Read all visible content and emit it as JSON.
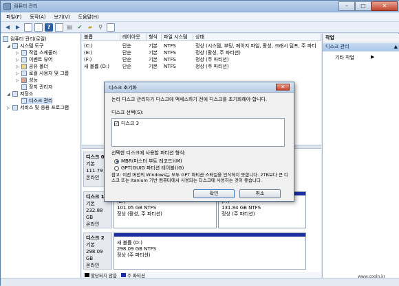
{
  "window": {
    "title": "컴퓨터 관리"
  },
  "title_controls": {
    "minimize": "–",
    "maximize": "□",
    "close": "✕"
  },
  "menubar": [
    "파일(F)",
    "동작(A)",
    "보기(V)",
    "도움말(H)"
  ],
  "tree": [
    {
      "label": "컴퓨터 관리(로컬)",
      "expander": "",
      "level": 0
    },
    {
      "label": "시스템 도구",
      "expander": "◢",
      "level": 1
    },
    {
      "label": "작업 스케줄러",
      "expander": "▷",
      "level": 2
    },
    {
      "label": "이벤트 뷰어",
      "expander": "▷",
      "level": 2
    },
    {
      "label": "공유 폴더",
      "expander": "▷",
      "level": 2
    },
    {
      "label": "로컬 사용자 및 그룹",
      "expander": "▷",
      "level": 2
    },
    {
      "label": "성능",
      "expander": "▷",
      "level": 2
    },
    {
      "label": "장치 관리자",
      "expander": "",
      "level": 2
    },
    {
      "label": "저장소",
      "expander": "◢",
      "level": 1
    },
    {
      "label": "디스크 관리",
      "expander": "",
      "level": 2,
      "selected": true
    },
    {
      "label": "서비스 및 응용 프로그램",
      "expander": "▷",
      "level": 1
    }
  ],
  "volume_table": {
    "headers": [
      "볼륨",
      "레이아웃",
      "형식",
      "파일 시스템",
      "상태"
    ],
    "rows": [
      [
        "(C:)",
        "단순",
        "기본",
        "NTFS",
        "정상 (시스템, 부팅, 페이지 파일, 활성, 크래시 덤프, 주 파티"
      ],
      [
        "(E:)",
        "단순",
        "기본",
        "NTFS",
        "정상 (활성, 주 파티션)"
      ],
      [
        "(F:)",
        "단순",
        "기본",
        "NTFS",
        "정상 (주 파티션)"
      ],
      [
        "새 볼륨 (D:)",
        "단순",
        "기본",
        "NTFS",
        "정상 (주 파티션)"
      ]
    ]
  },
  "disks": [
    {
      "name": "디스크 0",
      "type": "기본",
      "size": "111.79 G",
      "status": "온라인"
    },
    {
      "name": "디스크 1",
      "type": "기본",
      "size": "232.88 GB",
      "status": "온라인",
      "partitions": [
        {
          "drive": "(E:)",
          "size": "101.05 GB NTFS",
          "status": "정상 (활성, 주 파티션)"
        },
        {
          "drive": "(F:)",
          "size": "131.84 GB NTFS",
          "status": "정상 (주 파티션)"
        }
      ]
    },
    {
      "name": "디스크 2",
      "type": "기본",
      "size": "298.09 GB",
      "status": "온라인",
      "partitions": [
        {
          "drive": "새 볼륨 (D:)",
          "size": "298.09 GB NTFS",
          "status": "정상 (주 파티션)"
        }
      ]
    }
  ],
  "legend": [
    {
      "label": "할당되지 않음",
      "color": "#000000"
    },
    {
      "label": "주 파티션",
      "color": "#1d2fa0"
    }
  ],
  "actions": {
    "title": "작업",
    "selected": "디스크 관리",
    "selected_arrow": "▲",
    "item": "기타 작업",
    "item_arrow": "▶"
  },
  "dialog": {
    "title": "디스크 초기화",
    "close": "✕",
    "intro": "논리 디스크 관리자가 디스크에 액세스하기 전에 디스크를 초기화해야 합니다.",
    "select_label": "디스크 선택(S):",
    "disk_item": "디스크 3",
    "style_label": "선택한 디스크에 사용할 파티션 형식:",
    "options": [
      "MBR(마스터 부트 레코드)(M)",
      "GPT(GUID 파티션 테이블)(G)"
    ],
    "note": "참고: 이전 버전의 Windows는 모두 GPT 파티션 스타일을 인식하지 못합니다. 2TB보다 큰 디스크 또는 Itanium 기반 컴퓨터에서 사용되는 디스크에 사용하는 것이 좋습니다.",
    "ok": "확인",
    "cancel": "취소"
  },
  "watermark": {
    "logo": "COOLN",
    "site": "www.cooln.kr"
  }
}
